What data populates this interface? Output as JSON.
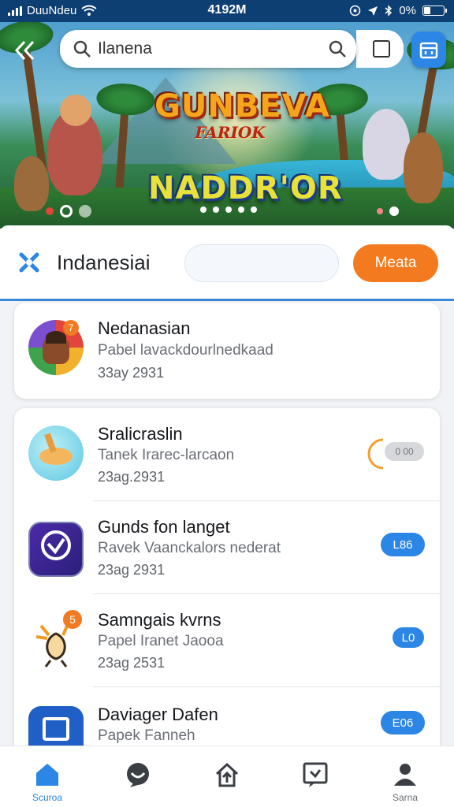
{
  "status_bar": {
    "carrier": "DuuNdeu",
    "time": "4192M",
    "battery": "0%"
  },
  "header": {
    "search_value": "Ilanena"
  },
  "banner": {
    "title_top": "GUNBEVA",
    "title_sub": "FARIOK",
    "title_main": "NADDR'OR"
  },
  "filter": {
    "label": "Indanesiai",
    "input_value": "",
    "button_label": "Meata"
  },
  "featured": {
    "title": "Nedanasian",
    "subtitle": "Pabel lavackdourlnedkaad",
    "date": "33ay 2931",
    "badge": "7"
  },
  "apps": [
    {
      "title": "Sralicraslin",
      "subtitle": "Tanek Irarec-larcaon",
      "date": "23ag.2931",
      "action": "0 00"
    },
    {
      "title": "Gunds fon langet",
      "subtitle": "Ravek Vaanckalors nederat",
      "date": "23ag 2931",
      "action": "L86"
    },
    {
      "title": "Samngais kvrns",
      "subtitle": "Papel Iranet Jaooa",
      "date": "23ag 2531",
      "action": "L0",
      "badge": "5"
    },
    {
      "title": "Daviager Dafen",
      "subtitle": "Papek Fanneh",
      "date": "",
      "action": "E06"
    }
  ],
  "nav": [
    {
      "label": "Scuroa",
      "icon": "home-icon"
    },
    {
      "label": "",
      "icon": "chat-icon"
    },
    {
      "label": "",
      "icon": "upload-icon"
    },
    {
      "label": "",
      "icon": "message-icon"
    },
    {
      "label": "Sarna",
      "icon": "profile-icon"
    }
  ],
  "colors": {
    "accent": "#2b86e5",
    "button_orange": "#f47a1f",
    "status_bar": "#0d3f72"
  }
}
